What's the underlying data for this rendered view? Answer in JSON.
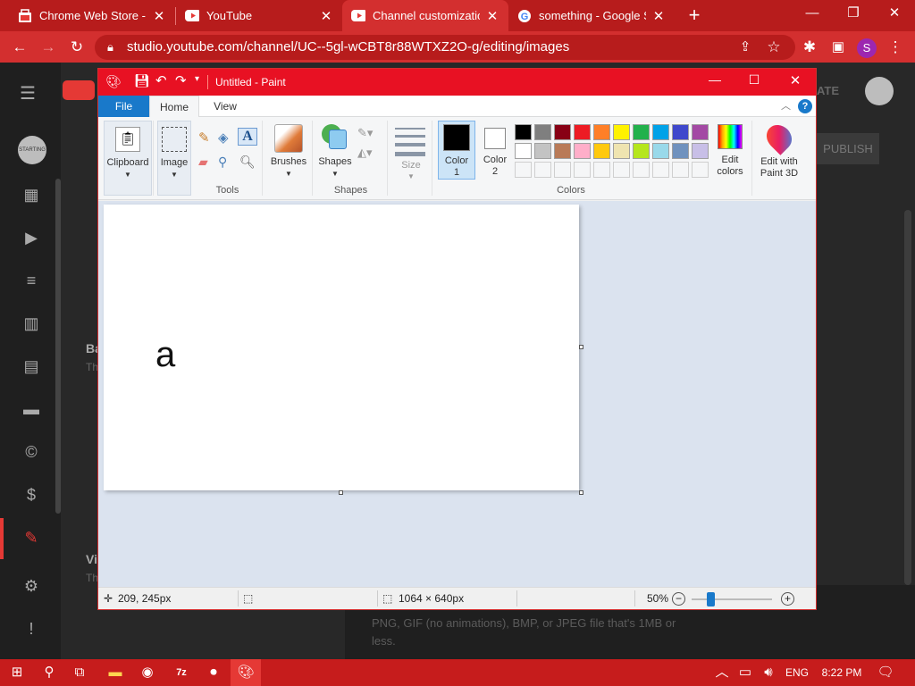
{
  "browser": {
    "tabs": [
      {
        "title": "Chrome Web Store - Ex",
        "icon": "chrome-web-store-icon"
      },
      {
        "title": "YouTube",
        "icon": "youtube-icon"
      },
      {
        "title": "Channel customization",
        "icon": "youtube-icon",
        "active": true
      },
      {
        "title": "something - Google Se",
        "icon": "google-icon"
      }
    ],
    "url": "studio.youtube.com/channel/UC--5gl-wCBT8r88WTXZ2O-g/editing/images",
    "profile_initial": "S"
  },
  "studio": {
    "avatar_text": "STARTING",
    "partial_labels": [
      "Ba",
      "Th",
      "Vi",
      "Th"
    ],
    "create_button": "ATE",
    "publish_button": "PUBLISH",
    "help_text": "PNG, GIF (no animations), BMP, or JPEG file that's 1MB or less."
  },
  "paint": {
    "title": "Untitled - Paint",
    "ribbon_tabs": {
      "file": "File",
      "home": "Home",
      "view": "View"
    },
    "groups": {
      "clipboard": "Clipboard",
      "image": "Image",
      "tools": "Tools",
      "brushes": "Brushes",
      "shapes": "Shapes",
      "shapes_group": "Shapes",
      "size": "Size",
      "color1": "Color 1",
      "color2": "Color 2",
      "colors": "Colors",
      "edit_colors": "Edit colors",
      "paint3d": "Edit with Paint 3D"
    },
    "palette_row1": [
      "#000000",
      "#7f7f7f",
      "#880015",
      "#ed1c24",
      "#ff7f27",
      "#fff200",
      "#22b14c",
      "#00a2e8",
      "#3f48cc",
      "#a349a4"
    ],
    "palette_row2": [
      "#ffffff",
      "#c3c3c3",
      "#b97a57",
      "#ffaec9",
      "#ffc90e",
      "#efe4b0",
      "#b5e61d",
      "#99d9ea",
      "#7092be",
      "#c8bfe7"
    ],
    "color1_value": "#000000",
    "color2_value": "#ffffff",
    "canvas_text": "a",
    "status": {
      "cursor_pos": "209, 245px",
      "image_size": "1064 × 640px",
      "zoom": "50%"
    }
  },
  "taskbar": {
    "language": "ENG",
    "time": "8:22 PM"
  }
}
